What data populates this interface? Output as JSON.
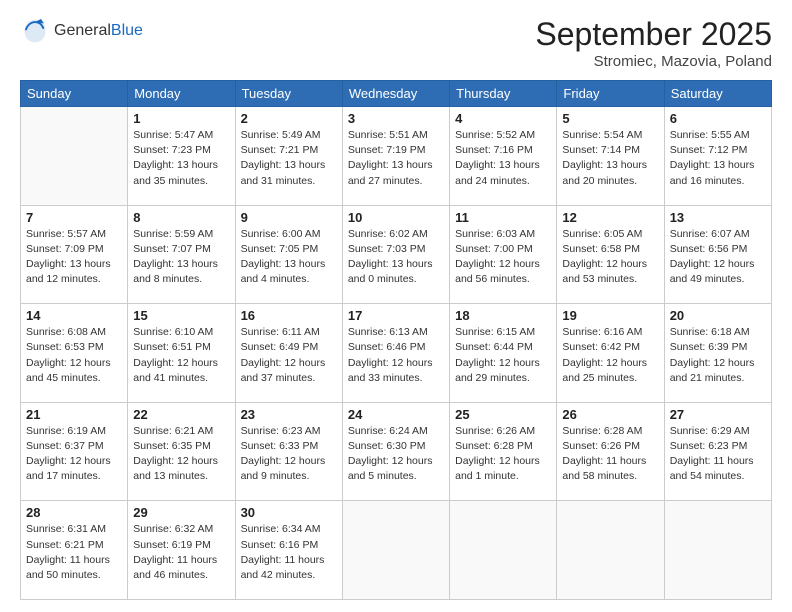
{
  "header": {
    "logo_general": "General",
    "logo_blue": "Blue",
    "month_title": "September 2025",
    "location": "Stromiec, Mazovia, Poland"
  },
  "weekdays": [
    "Sunday",
    "Monday",
    "Tuesday",
    "Wednesday",
    "Thursday",
    "Friday",
    "Saturday"
  ],
  "weeks": [
    [
      {
        "day": "",
        "info": ""
      },
      {
        "day": "1",
        "info": "Sunrise: 5:47 AM\nSunset: 7:23 PM\nDaylight: 13 hours\nand 35 minutes."
      },
      {
        "day": "2",
        "info": "Sunrise: 5:49 AM\nSunset: 7:21 PM\nDaylight: 13 hours\nand 31 minutes."
      },
      {
        "day": "3",
        "info": "Sunrise: 5:51 AM\nSunset: 7:19 PM\nDaylight: 13 hours\nand 27 minutes."
      },
      {
        "day": "4",
        "info": "Sunrise: 5:52 AM\nSunset: 7:16 PM\nDaylight: 13 hours\nand 24 minutes."
      },
      {
        "day": "5",
        "info": "Sunrise: 5:54 AM\nSunset: 7:14 PM\nDaylight: 13 hours\nand 20 minutes."
      },
      {
        "day": "6",
        "info": "Sunrise: 5:55 AM\nSunset: 7:12 PM\nDaylight: 13 hours\nand 16 minutes."
      }
    ],
    [
      {
        "day": "7",
        "info": "Sunrise: 5:57 AM\nSunset: 7:09 PM\nDaylight: 13 hours\nand 12 minutes."
      },
      {
        "day": "8",
        "info": "Sunrise: 5:59 AM\nSunset: 7:07 PM\nDaylight: 13 hours\nand 8 minutes."
      },
      {
        "day": "9",
        "info": "Sunrise: 6:00 AM\nSunset: 7:05 PM\nDaylight: 13 hours\nand 4 minutes."
      },
      {
        "day": "10",
        "info": "Sunrise: 6:02 AM\nSunset: 7:03 PM\nDaylight: 13 hours\nand 0 minutes."
      },
      {
        "day": "11",
        "info": "Sunrise: 6:03 AM\nSunset: 7:00 PM\nDaylight: 12 hours\nand 56 minutes."
      },
      {
        "day": "12",
        "info": "Sunrise: 6:05 AM\nSunset: 6:58 PM\nDaylight: 12 hours\nand 53 minutes."
      },
      {
        "day": "13",
        "info": "Sunrise: 6:07 AM\nSunset: 6:56 PM\nDaylight: 12 hours\nand 49 minutes."
      }
    ],
    [
      {
        "day": "14",
        "info": "Sunrise: 6:08 AM\nSunset: 6:53 PM\nDaylight: 12 hours\nand 45 minutes."
      },
      {
        "day": "15",
        "info": "Sunrise: 6:10 AM\nSunset: 6:51 PM\nDaylight: 12 hours\nand 41 minutes."
      },
      {
        "day": "16",
        "info": "Sunrise: 6:11 AM\nSunset: 6:49 PM\nDaylight: 12 hours\nand 37 minutes."
      },
      {
        "day": "17",
        "info": "Sunrise: 6:13 AM\nSunset: 6:46 PM\nDaylight: 12 hours\nand 33 minutes."
      },
      {
        "day": "18",
        "info": "Sunrise: 6:15 AM\nSunset: 6:44 PM\nDaylight: 12 hours\nand 29 minutes."
      },
      {
        "day": "19",
        "info": "Sunrise: 6:16 AM\nSunset: 6:42 PM\nDaylight: 12 hours\nand 25 minutes."
      },
      {
        "day": "20",
        "info": "Sunrise: 6:18 AM\nSunset: 6:39 PM\nDaylight: 12 hours\nand 21 minutes."
      }
    ],
    [
      {
        "day": "21",
        "info": "Sunrise: 6:19 AM\nSunset: 6:37 PM\nDaylight: 12 hours\nand 17 minutes."
      },
      {
        "day": "22",
        "info": "Sunrise: 6:21 AM\nSunset: 6:35 PM\nDaylight: 12 hours\nand 13 minutes."
      },
      {
        "day": "23",
        "info": "Sunrise: 6:23 AM\nSunset: 6:33 PM\nDaylight: 12 hours\nand 9 minutes."
      },
      {
        "day": "24",
        "info": "Sunrise: 6:24 AM\nSunset: 6:30 PM\nDaylight: 12 hours\nand 5 minutes."
      },
      {
        "day": "25",
        "info": "Sunrise: 6:26 AM\nSunset: 6:28 PM\nDaylight: 12 hours\nand 1 minute."
      },
      {
        "day": "26",
        "info": "Sunrise: 6:28 AM\nSunset: 6:26 PM\nDaylight: 11 hours\nand 58 minutes."
      },
      {
        "day": "27",
        "info": "Sunrise: 6:29 AM\nSunset: 6:23 PM\nDaylight: 11 hours\nand 54 minutes."
      }
    ],
    [
      {
        "day": "28",
        "info": "Sunrise: 6:31 AM\nSunset: 6:21 PM\nDaylight: 11 hours\nand 50 minutes."
      },
      {
        "day": "29",
        "info": "Sunrise: 6:32 AM\nSunset: 6:19 PM\nDaylight: 11 hours\nand 46 minutes."
      },
      {
        "day": "30",
        "info": "Sunrise: 6:34 AM\nSunset: 6:16 PM\nDaylight: 11 hours\nand 42 minutes."
      },
      {
        "day": "",
        "info": ""
      },
      {
        "day": "",
        "info": ""
      },
      {
        "day": "",
        "info": ""
      },
      {
        "day": "",
        "info": ""
      }
    ]
  ]
}
